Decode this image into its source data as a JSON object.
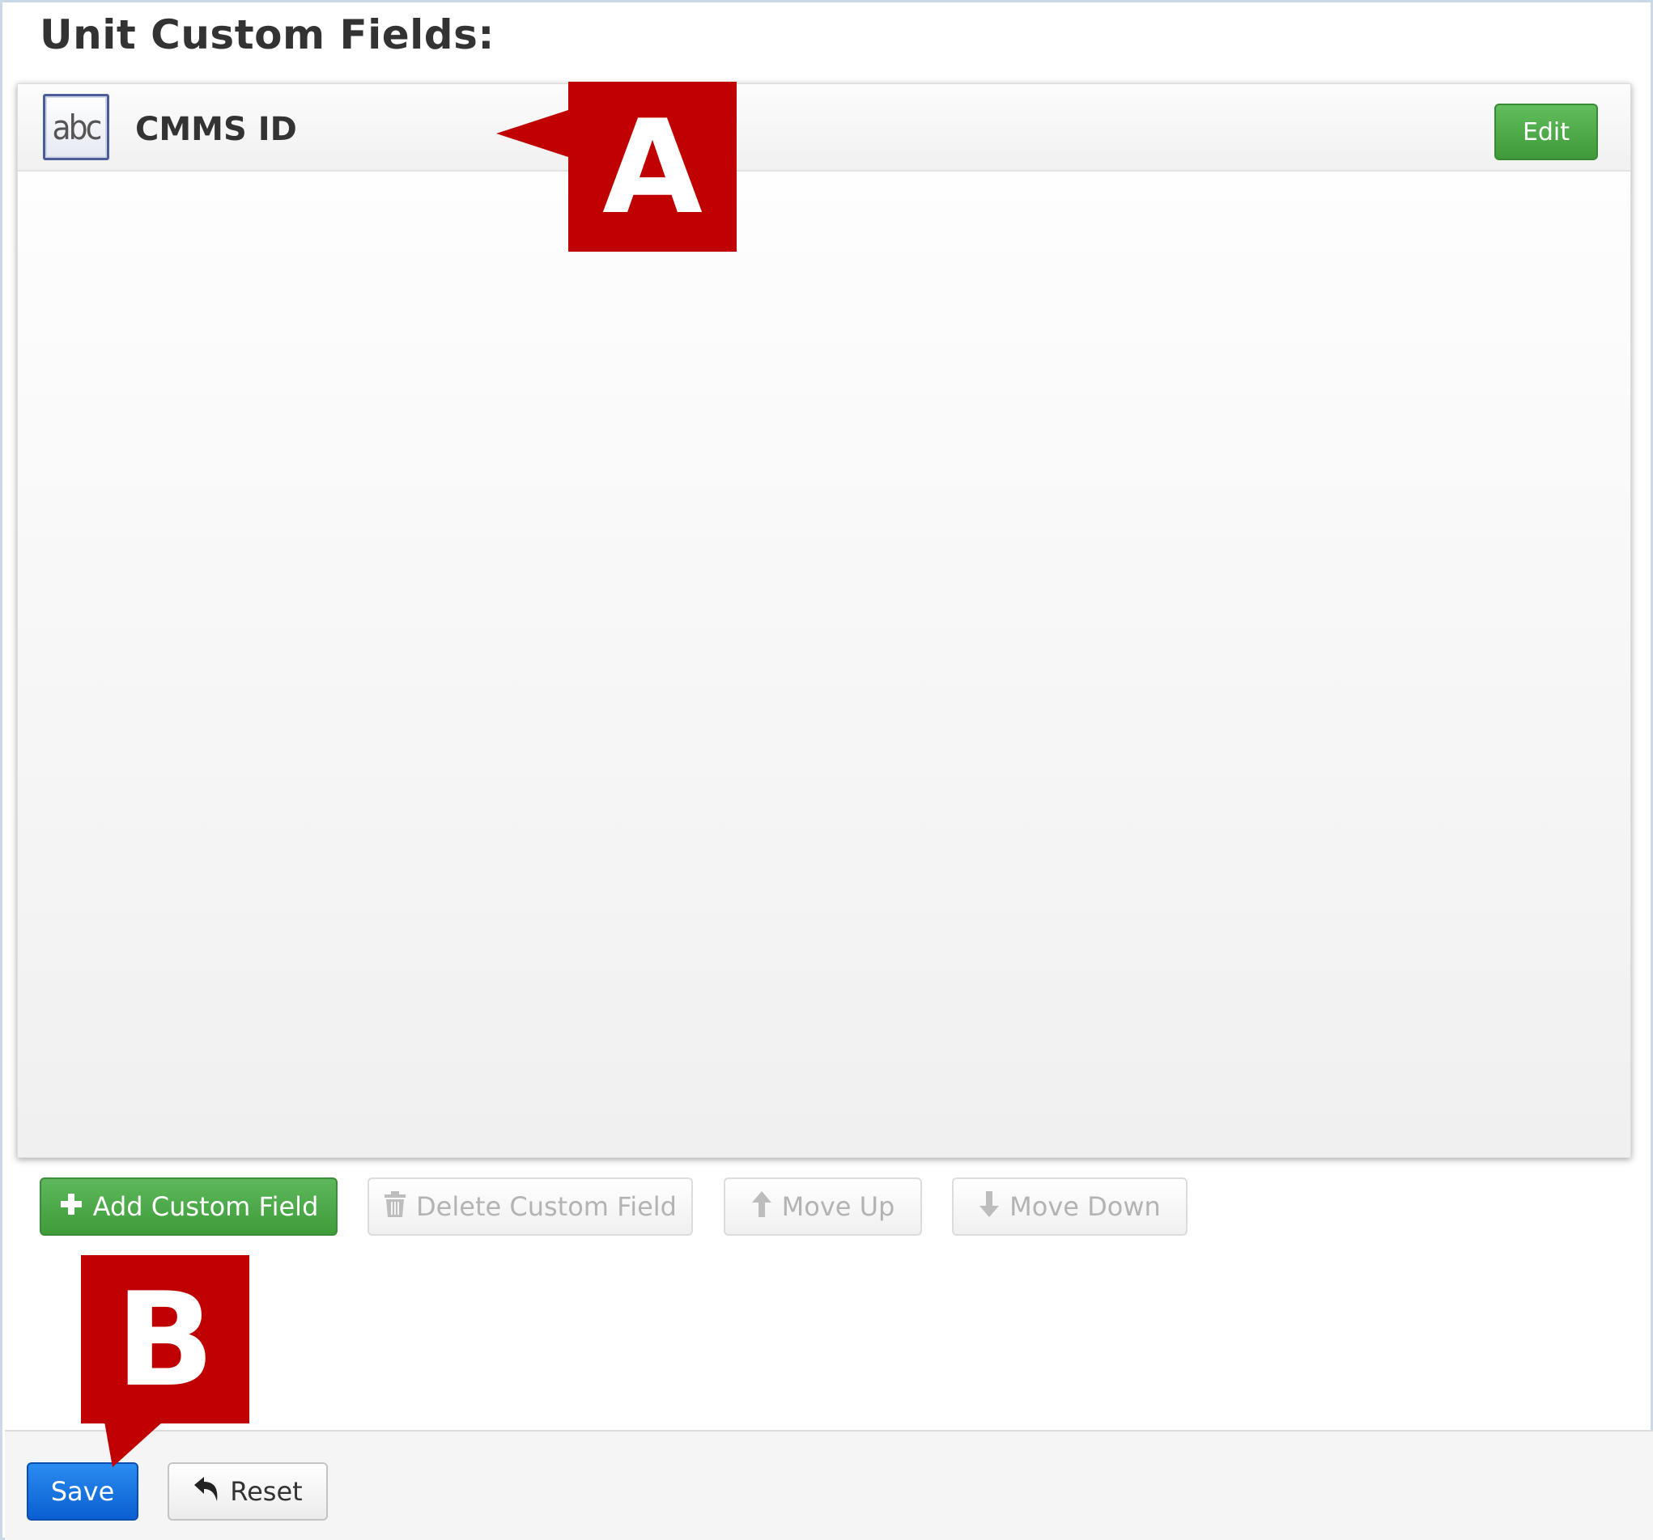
{
  "page": {
    "title": "Unit Custom Fields:"
  },
  "fields": [
    {
      "icon": "abc",
      "name": "CMMS ID",
      "edit_label": "Edit"
    }
  ],
  "actions": {
    "add_label": "Add Custom Field",
    "delete_label": "Delete Custom Field",
    "move_up_label": "Move Up",
    "move_down_label": "Move Down"
  },
  "footer": {
    "save_label": "Save",
    "reset_label": "Reset"
  },
  "callouts": {
    "a": "A",
    "b": "B"
  },
  "colors": {
    "primary_button": "#0a5fd1",
    "success_button": "#3f9c3b",
    "callout": "#c00000"
  },
  "icons": {
    "field_type": "text-field-abc-icon",
    "add": "plus-icon",
    "delete": "trash-icon",
    "move_up": "arrow-up-icon",
    "move_down": "arrow-down-icon",
    "reset": "undo-icon"
  }
}
